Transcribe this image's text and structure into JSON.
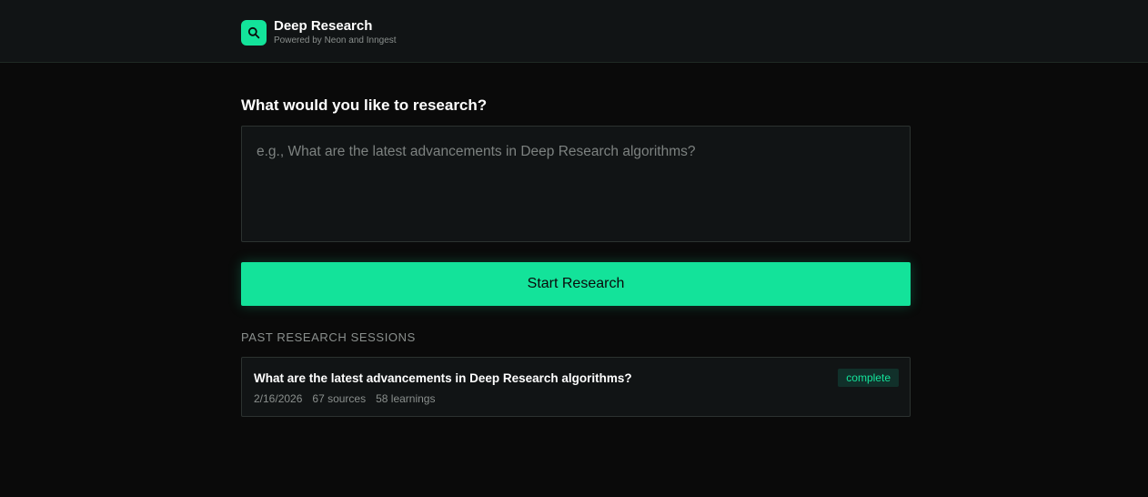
{
  "header": {
    "title": "Deep Research",
    "subtitle": "Powered by Neon and Inngest",
    "logo_icon": "search-icon",
    "accent_color": "#13e39a"
  },
  "main": {
    "heading": "What would you like to research?",
    "query_input": {
      "value": "",
      "placeholder": "e.g., What are the latest advancements in Deep Research algorithms?"
    },
    "start_button_label": "Start Research"
  },
  "past_sessions": {
    "heading": "PAST RESEARCH SESSIONS",
    "items": [
      {
        "title": "What are the latest advancements in Deep Research algorithms?",
        "date": "2/16/2026",
        "sources": "67 sources",
        "learnings": "58 learnings",
        "status": "complete"
      }
    ]
  }
}
